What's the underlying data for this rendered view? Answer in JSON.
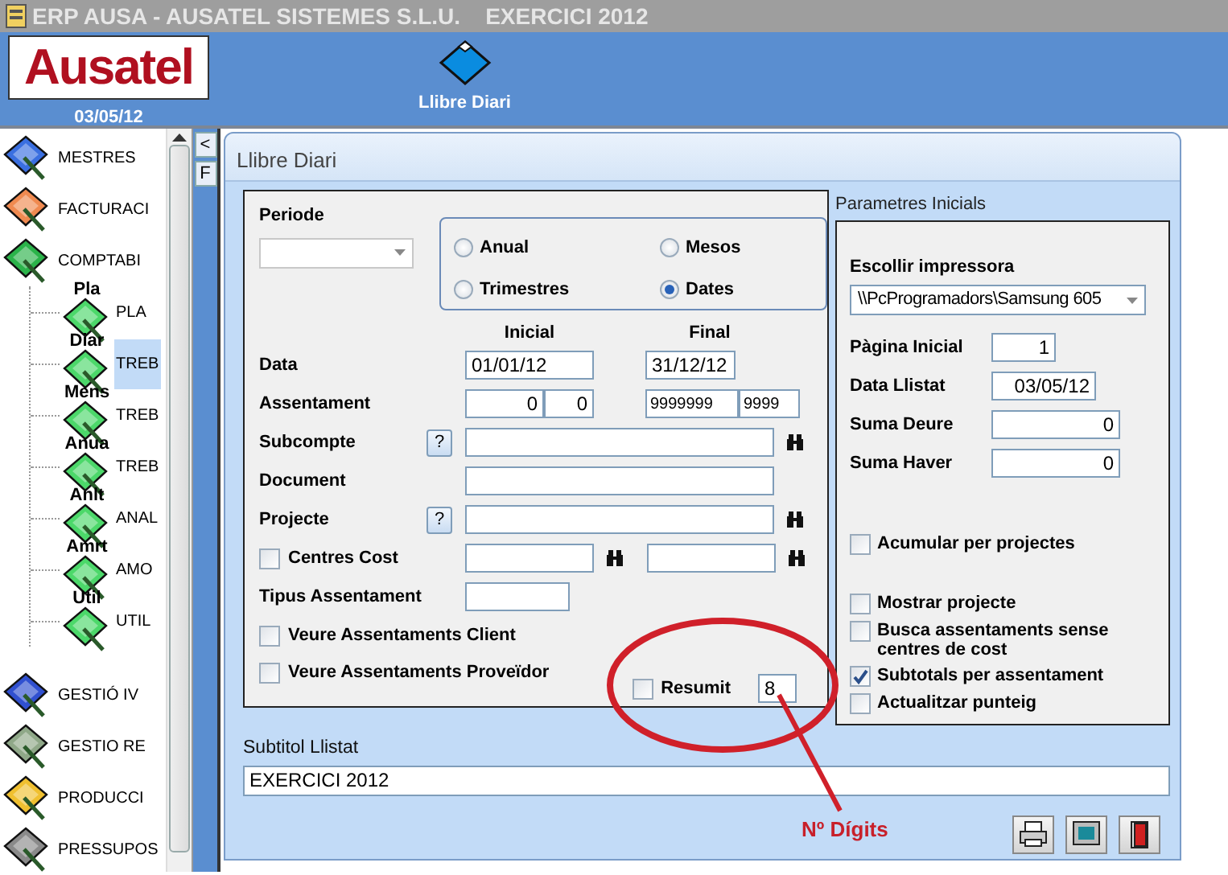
{
  "window": {
    "title": "ERP AUSA - AUSATEL SISTEMES S.L.U.    EXERCICI 2012"
  },
  "header": {
    "logo": "Ausatel",
    "date": "03/05/12",
    "module": "Llibre Diari"
  },
  "side_tabs": [
    "<",
    "F"
  ],
  "sidebar": {
    "items": [
      {
        "label": "MESTRES",
        "color": "#3a6fe0",
        "selected": false
      },
      {
        "label": "FACTURACI",
        "color": "#f08a50",
        "selected": false
      },
      {
        "label": "COMPTABI",
        "color": "#2bb34a",
        "selected": false,
        "expanded": true,
        "children": [
          {
            "badge": "Pla",
            "label": "PLA",
            "selected": false
          },
          {
            "badge": "Diar",
            "label": "TREB",
            "selected": true
          },
          {
            "badge": "Mens",
            "label": "TREB",
            "selected": false
          },
          {
            "badge": "Anua",
            "label": "TREB",
            "selected": false
          },
          {
            "badge": "Anlt",
            "label": "ANAL",
            "selected": false
          },
          {
            "badge": "Amrt",
            "label": "AMO",
            "selected": false
          },
          {
            "badge": "Util",
            "label": "UTIL",
            "selected": false
          }
        ]
      },
      {
        "label": "GESTIÓ IV",
        "color": "#3050d0",
        "selected": false
      },
      {
        "label": "GESTIO RE",
        "color": "#8fa888",
        "selected": false
      },
      {
        "label": "PRODUCCI",
        "color": "#f0c030",
        "selected": false
      },
      {
        "label": "PRESSUPOS",
        "color": "#8a8a8a",
        "selected": false
      }
    ]
  },
  "form": {
    "title": "Llibre Diari",
    "periode": {
      "label": "Periode"
    },
    "period_options": [
      {
        "label": "Anual",
        "selected": false
      },
      {
        "label": "Mesos",
        "selected": false
      },
      {
        "label": "Trimestres",
        "selected": false
      },
      {
        "label": "Dates",
        "selected": true
      }
    ],
    "range_headers": [
      "Inicial",
      "Final"
    ],
    "rows": [
      {
        "kind": "range",
        "label": "Data",
        "from": [
          "01/01/12"
        ],
        "to": [
          "31/12/12"
        ]
      },
      {
        "kind": "range",
        "label": "Assentament",
        "from": [
          "0",
          "0"
        ],
        "to": [
          "9999999",
          "9999"
        ]
      },
      {
        "kind": "lookup",
        "label": "Subcompte",
        "help": "?"
      },
      {
        "kind": "text",
        "label": "Document"
      },
      {
        "kind": "lookup",
        "label": "Projecte",
        "help": "?"
      },
      {
        "kind": "cost_range",
        "label": "Centres Cost",
        "checked": false
      },
      {
        "kind": "short",
        "label": "Tipus Assentament"
      },
      {
        "kind": "check",
        "label": "Veure  Assentaments Client",
        "checked": false
      },
      {
        "kind": "check",
        "label": "Veure Assentaments Proveïdor",
        "checked": false
      }
    ],
    "resumit": {
      "label": "Resumit",
      "checked": false,
      "value": "8"
    },
    "params": {
      "title": "Parametres Inicials",
      "printer_label": "Escollir impressora",
      "printer": "\\\\PcProgramadors\\Samsung 605",
      "fields": [
        {
          "label": "Pàgina Inicial",
          "value": "1"
        },
        {
          "label": "Data Llistat",
          "value": "03/05/12"
        },
        {
          "label": "Suma Deure",
          "value": "0"
        },
        {
          "label": "Suma Haver",
          "value": "0"
        }
      ],
      "checks_top": [
        {
          "label": "Acumular per projectes",
          "checked": false
        }
      ],
      "checks_bottom": [
        {
          "label": "Mostrar projecte",
          "checked": false
        },
        {
          "label": "Busca assentaments sense centres de cost",
          "checked": false
        },
        {
          "label": "Subtotals per assentament",
          "checked": true
        },
        {
          "label": "Actualitzar punteig",
          "checked": false
        }
      ]
    },
    "subtitle": {
      "label": "Subtitol Llistat",
      "value": "EXERCICI 2012"
    },
    "buttons": [
      {
        "kind": "print"
      },
      {
        "kind": "preview"
      },
      {
        "kind": "exit"
      }
    ]
  },
  "annotation": {
    "label": "Nº Dígits"
  }
}
